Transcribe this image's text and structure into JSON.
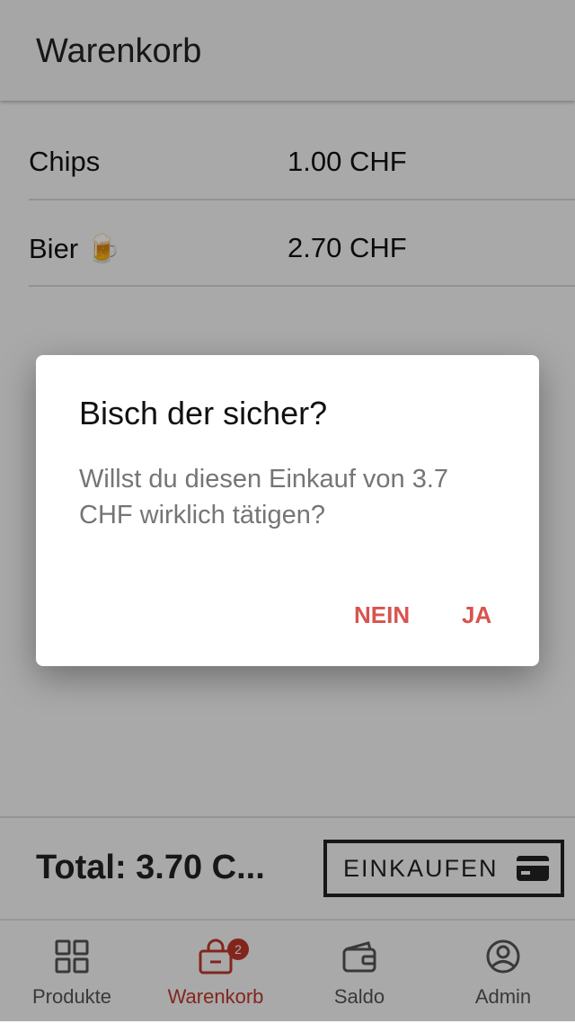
{
  "appbar": {
    "title": "Warenkorb"
  },
  "cart": {
    "items": [
      {
        "name": "Chips",
        "price": "1.00 CHF"
      },
      {
        "name": "Bier 🍺",
        "price": "2.70 CHF"
      }
    ]
  },
  "footer": {
    "total": "Total: 3.70 C...",
    "buy_label": "EINKAUFEN",
    "buy_icon": "credit-card-icon"
  },
  "nav": {
    "items": [
      {
        "label": "Produkte",
        "icon": "grid-icon",
        "active": false
      },
      {
        "label": "Warenkorb",
        "icon": "shopping-bag-icon",
        "active": true,
        "badge": "2"
      },
      {
        "label": "Saldo",
        "icon": "wallet-icon",
        "active": false
      },
      {
        "label": "Admin",
        "icon": "account-circle-icon",
        "active": false
      }
    ]
  },
  "dialog": {
    "title": "Bisch der sicher?",
    "message": "Willst du diesen Einkauf von 3.7 CHF wirklich tätigen?",
    "cancel_label": "NEIN",
    "confirm_label": "JA"
  },
  "colors": {
    "accent": "#d9534f",
    "active_nav": "#c0392b",
    "badge": "#c0392b"
  }
}
